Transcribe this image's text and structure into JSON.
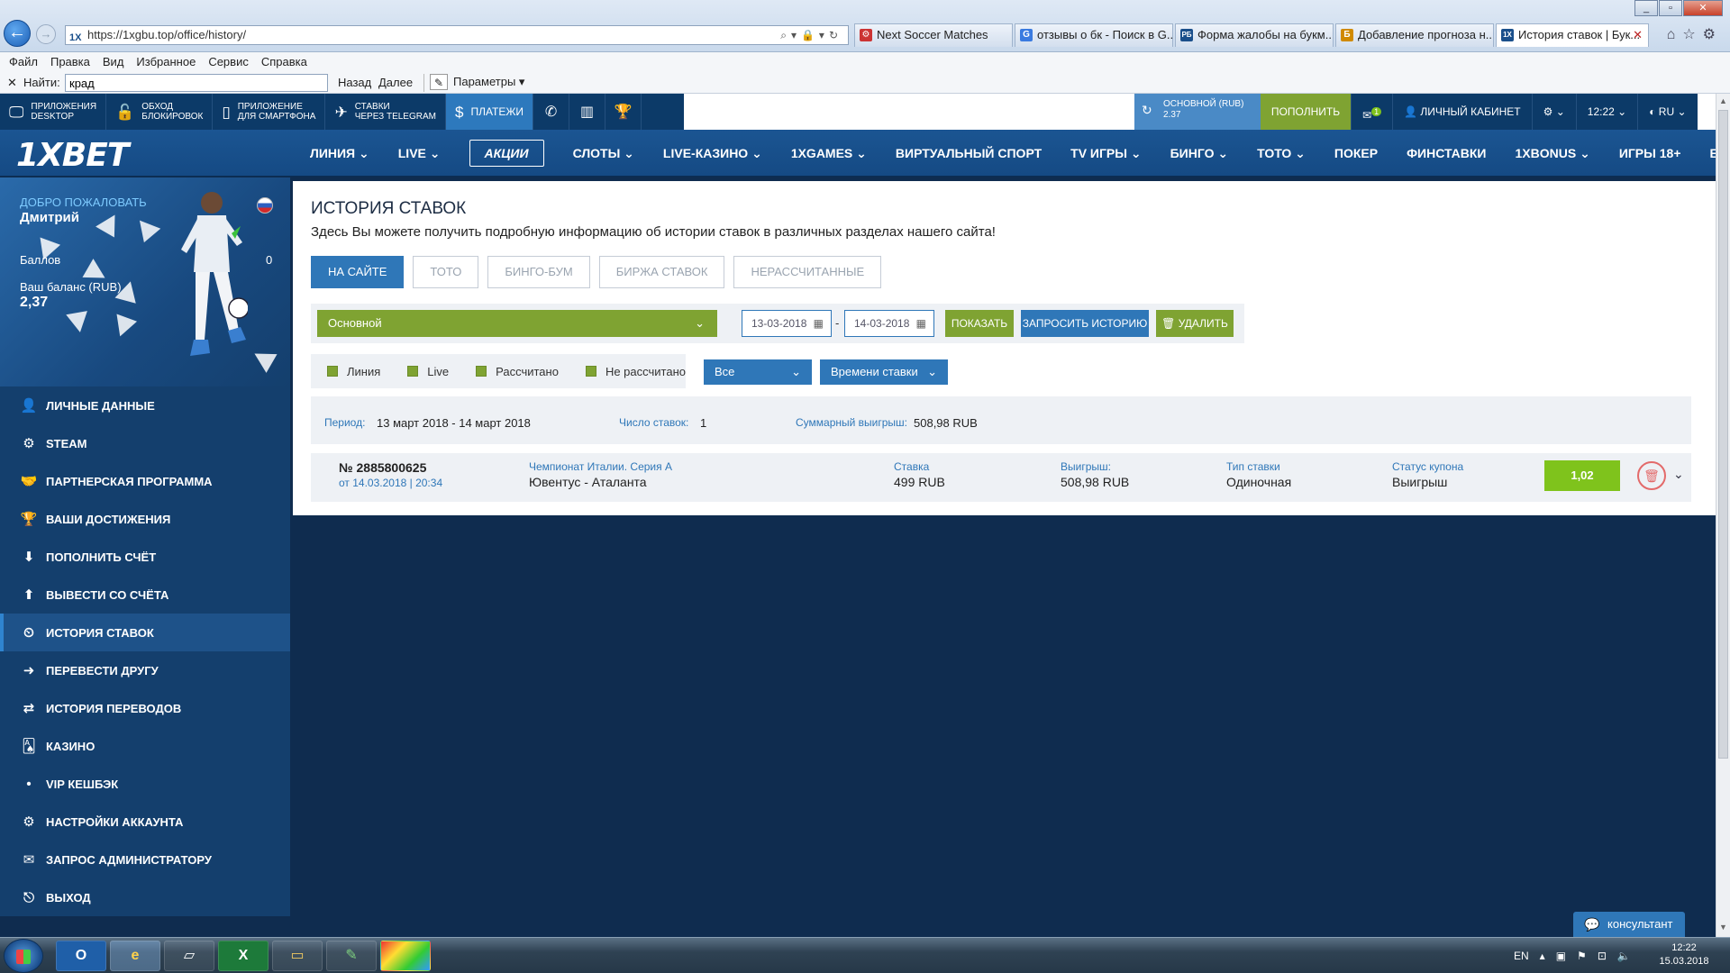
{
  "browser": {
    "url": "https://1xgbu.top/office/history/",
    "favicon": "1X",
    "tabs": [
      {
        "label": "Next Soccer Matches",
        "icon": "⚙",
        "color": "#c33"
      },
      {
        "label": "отзывы о бк - Поиск в G...",
        "icon": "G",
        "color": "#3a7be0"
      },
      {
        "label": "Форма жалобы на букм...",
        "icon": "РБ",
        "color": "#1a4f8b"
      },
      {
        "label": "Добавление прогноза н...",
        "icon": "Б",
        "color": "#d08a00"
      },
      {
        "label": "История ставок | Бук...",
        "icon": "1X",
        "color": "#1a4f8b"
      }
    ],
    "menu": [
      "Файл",
      "Правка",
      "Вид",
      "Избранное",
      "Сервис",
      "Справка"
    ],
    "find_label": "Найти:",
    "find_value": "крад",
    "find_prev": "Назад",
    "find_next": "Далее",
    "find_params": "Параметры"
  },
  "topbar": {
    "app_desktop_1": "ПРИЛОЖЕНИЯ",
    "app_desktop_2": "DESKTOP",
    "bypass_1": "ОБХОД",
    "bypass_2": "БЛОКИРОВОК",
    "mobile_1": "ПРИЛОЖЕНИЕ",
    "mobile_2": "ДЛЯ СМАРТФОНА",
    "telegram_1": "СТАВКИ",
    "telegram_2": "ЧЕРЕЗ TELEGRAM",
    "payments": "ПЛАТЕЖИ",
    "balance_label": "ОСНОВНОЙ (RUB)",
    "balance_value": "2.37",
    "deposit": "ПОПОЛНИТЬ",
    "messages_badge": "1",
    "cabinet": "ЛИЧНЫЙ КАБИНЕТ",
    "time": "12:22",
    "lang": "RU"
  },
  "logo": "1XBET",
  "nav": [
    "ЛИНИЯ ⌄",
    "LIVE ⌄",
    "АКЦИИ",
    "СЛОТЫ ⌄",
    "LIVE-КАЗИНО ⌄",
    "1XGAMES ⌄",
    "ВИРТУАЛЬНЫЙ СПОРТ",
    "TV ИГРЫ ⌄",
    "БИНГО ⌄",
    "ТОТО ⌄",
    "ПОКЕР",
    "ФИНСТАВКИ",
    "1XBONUS ⌄",
    "ИГРЫ 18+",
    "ЕЩЁ ⌄"
  ],
  "profile": {
    "welcome": "ДОБРО ПОЖАЛОВАТЬ",
    "name": "Дмитрий",
    "points_label": "Баллов",
    "points_value": "0",
    "balance_label": "Ваш баланс (RUB)",
    "balance_value": "2,37"
  },
  "sidebar": [
    {
      "label": "ЛИЧНЫЕ ДАННЫЕ",
      "icon": "👤"
    },
    {
      "label": "STEAM",
      "icon": "⚙"
    },
    {
      "label": "ПАРТНЕРСКАЯ ПРОГРАММА",
      "icon": "🤝"
    },
    {
      "label": "ВАШИ ДОСТИЖЕНИЯ",
      "icon": "🏆"
    },
    {
      "label": "ПОПОЛНИТЬ СЧЁТ",
      "icon": "⬇"
    },
    {
      "label": "ВЫВЕСТИ СО СЧЁТА",
      "icon": "⬆"
    },
    {
      "label": "ИСТОРИЯ СТАВОК",
      "icon": "⏲"
    },
    {
      "label": "ПЕРЕВЕСТИ ДРУГУ",
      "icon": "➜"
    },
    {
      "label": "ИСТОРИЯ ПЕРЕВОДОВ",
      "icon": "⇄"
    },
    {
      "label": "КАЗИНО",
      "icon": "🂡"
    },
    {
      "label": "VIP КЕШБЭК",
      "icon": "•"
    },
    {
      "label": "НАСТРОЙКИ АККАУНТА",
      "icon": "⚙"
    },
    {
      "label": "ЗАПРОС АДМИНИСТРАТОРУ",
      "icon": "✉"
    },
    {
      "label": "ВЫХОД",
      "icon": "⎋"
    }
  ],
  "content": {
    "title": "ИСТОРИЯ СТАВОК",
    "subtitle": "Здесь Вы можете получить подробную информацию об истории ставок в различных разделах нашего сайта!",
    "tabs": [
      "НА САЙТЕ",
      "ТОТО",
      "БИНГО-БУМ",
      "БИРЖА СТАВОК",
      "НЕРАССЧИТАННЫЕ"
    ],
    "account_select": "Основной",
    "date_from": "13-03-2018",
    "date_to": "14-03-2018",
    "show_button": "ПОКАЗАТЬ",
    "request_button": "ЗАПРОСИТЬ ИСТОРИЮ",
    "delete_button": "УДАЛИТЬ",
    "checks": [
      "Линия",
      "Live",
      "Рассчитано",
      "Не рассчитано"
    ],
    "filter_all": "Все",
    "filter_time": "Времени ставки",
    "summary": {
      "period_label": "Период:",
      "period_value": "13 март 2018 - 14 март 2018",
      "count_label": "Число ставок:",
      "count_value": "1",
      "win_label": "Суммарный выигрыш:",
      "win_value": "508,98 RUB"
    },
    "bet": {
      "number": "№ 2885800625",
      "date": "от 14.03.2018 | 20:34",
      "league": "Чемпионат Италии. Серия А",
      "match": "Ювентус - Аталанта",
      "stake_label": "Ставка",
      "stake_value": "499 RUB",
      "win_label": "Выигрыш:",
      "win_value": "508,98 RUB",
      "type_label": "Тип ставки",
      "type_value": "Одиночная",
      "status_label": "Статус купона",
      "status_value": "Выигрыш",
      "coef": "1,02"
    }
  },
  "consultant": "консультант",
  "taskbar": {
    "lang": "EN",
    "time": "12:22",
    "date": "15.03.2018"
  },
  "colors": {
    "brand_navy": "#0c3a68",
    "accent_blue": "#2f77b8",
    "accent_green": "#7fa332",
    "coef_green": "#7fc31c"
  }
}
